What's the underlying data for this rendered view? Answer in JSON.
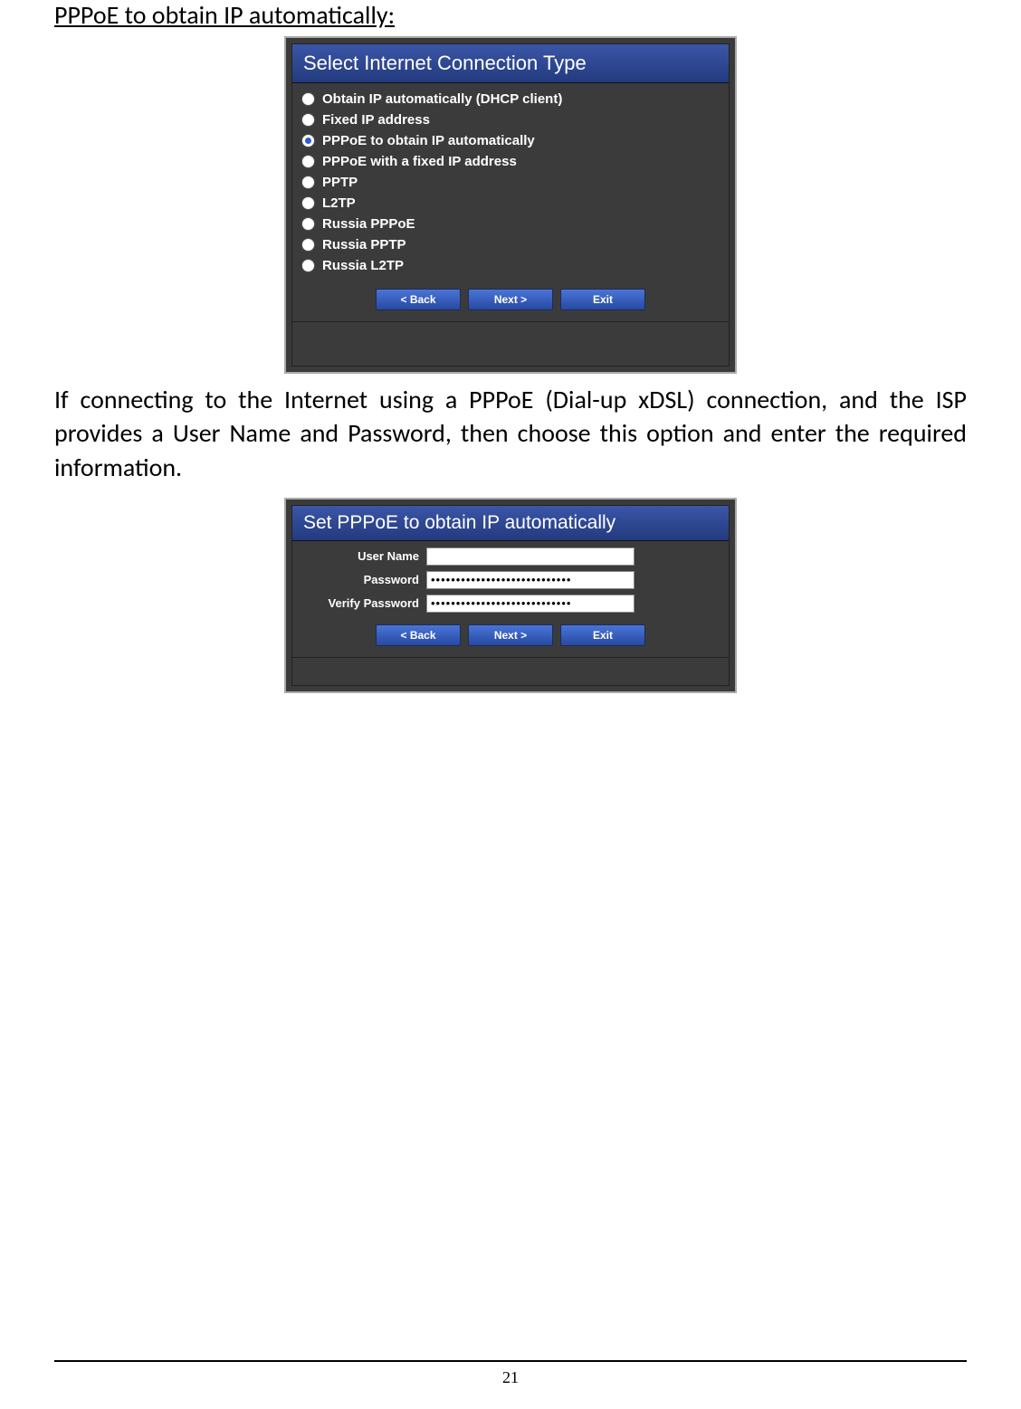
{
  "heading": "PPPoE to obtain IP automatically:",
  "body_paragraph": "If connecting to the Internet using a PPPoE (Dial-up xDSL) connection, and the ISP provides a User Name and Password, then choose this option and enter the required information.",
  "dialog1": {
    "title": "Select Internet Connection Type",
    "options": [
      {
        "label": "Obtain IP automatically (DHCP client)",
        "selected": false
      },
      {
        "label": "Fixed IP address",
        "selected": false
      },
      {
        "label": "PPPoE to obtain IP automatically",
        "selected": true
      },
      {
        "label": "PPPoE with a fixed IP address",
        "selected": false
      },
      {
        "label": "PPTP",
        "selected": false
      },
      {
        "label": "L2TP",
        "selected": false
      },
      {
        "label": "Russia PPPoE",
        "selected": false
      },
      {
        "label": "Russia PPTP",
        "selected": false
      },
      {
        "label": "Russia L2TP",
        "selected": false
      }
    ],
    "buttons": {
      "back": "< Back",
      "next": "Next >",
      "exit": "Exit"
    }
  },
  "dialog2": {
    "title": "Set PPPoE to obtain IP automatically",
    "fields": {
      "username_label": "User Name",
      "username_value": "",
      "password_label": "Password",
      "password_value": "••••••••••••••••••••••••••••",
      "verify_label": "Verify Password",
      "verify_value": "••••••••••••••••••••••••••••"
    },
    "buttons": {
      "back": "< Back",
      "next": "Next >",
      "exit": "Exit"
    }
  },
  "page_number": "21"
}
